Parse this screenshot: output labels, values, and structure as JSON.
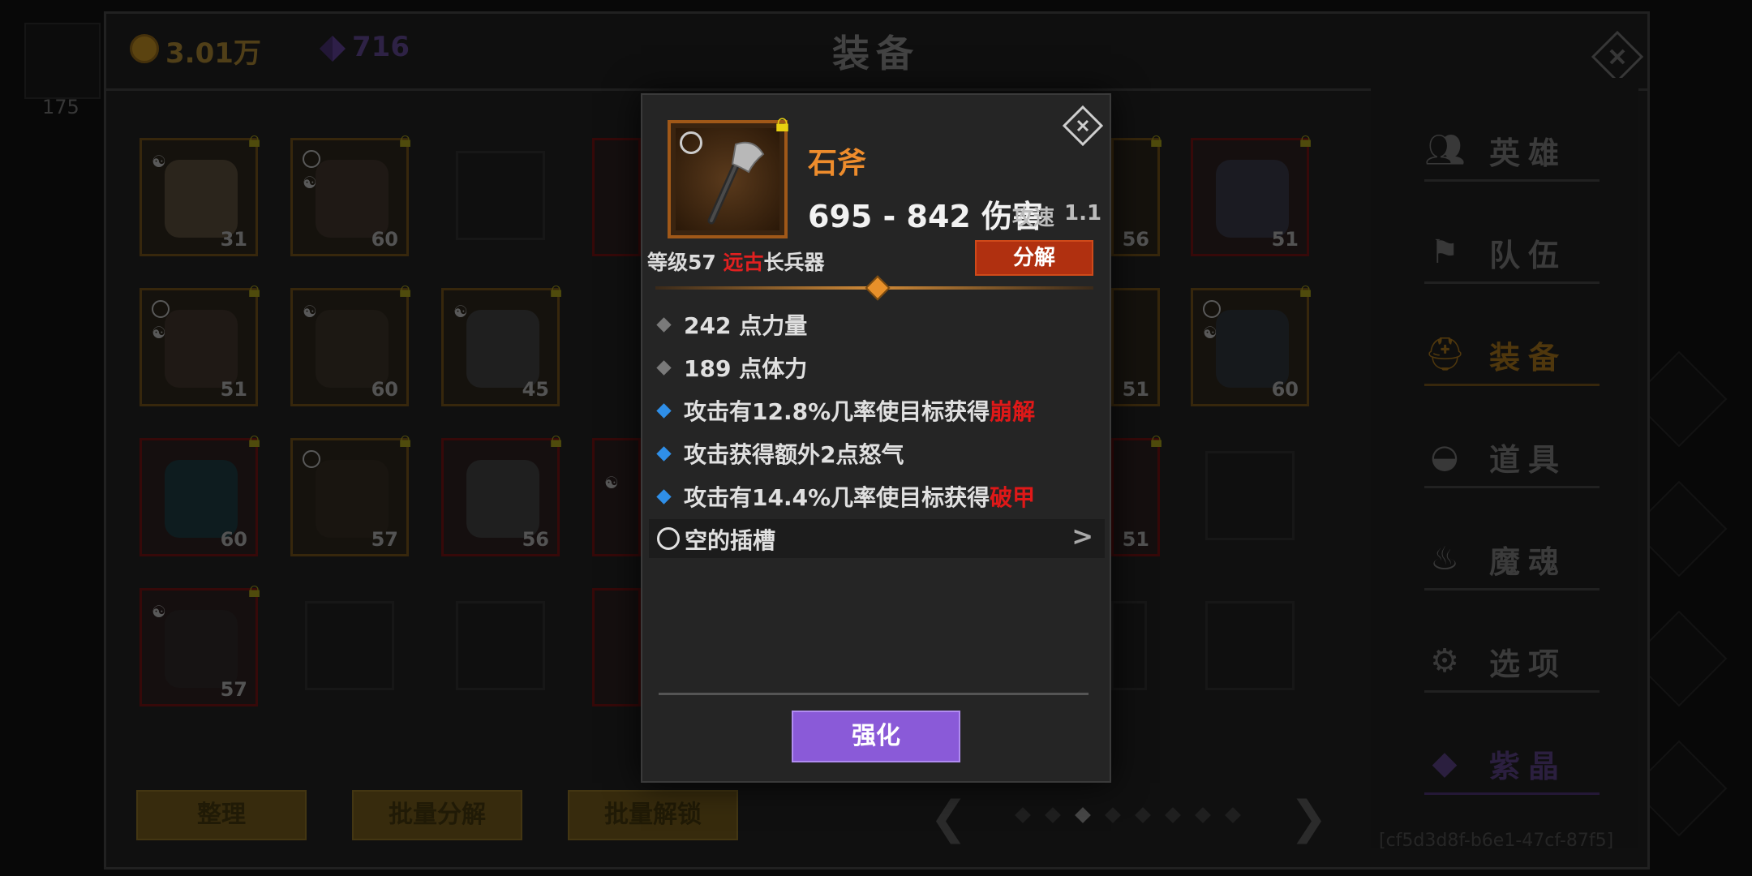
{
  "hud": {
    "left_number": "175"
  },
  "header": {
    "gold": "3.01万",
    "gems": "716",
    "title": "装备"
  },
  "inventory": {
    "items": [
      {
        "level": "31"
      },
      {
        "level": "60"
      },
      {
        "level": "56"
      },
      {
        "level": "51"
      },
      {
        "level": "51"
      },
      {
        "level": "60"
      },
      {
        "level": "45"
      },
      {
        "level": "51"
      },
      {
        "level": "60"
      },
      {
        "level": "60"
      },
      {
        "level": "57"
      },
      {
        "level": "56"
      },
      {
        "level": "51"
      },
      {
        "level": "57"
      }
    ]
  },
  "bottom_buttons": {
    "sort": "整理",
    "batch_decompose": "批量分解",
    "batch_unlock": "批量解锁"
  },
  "pager": {
    "total": 8,
    "current": 3
  },
  "nav": {
    "items": [
      {
        "label": "英雄",
        "icon": "users-icon"
      },
      {
        "label": "队伍",
        "icon": "flag-icon"
      },
      {
        "label": "装备",
        "icon": "helmet-icon",
        "active": true
      },
      {
        "label": "道具",
        "icon": "bag-icon"
      },
      {
        "label": "魔魂",
        "icon": "flame-icon"
      },
      {
        "label": "选项",
        "icon": "gear-icon"
      },
      {
        "label": "紫晶",
        "icon": "crystal-icon"
      }
    ]
  },
  "uuid": "[cf5d3d8f-b6e1-47cf-87f5]",
  "modal": {
    "name": "石斧",
    "damage": "695 - 842 伤害",
    "speed_label": "攻速",
    "speed_value": "1.1",
    "level_text": "等级57",
    "rarity": "远古",
    "type": "长兵器",
    "decompose": "分解",
    "stats": [
      {
        "text": "242 点力量",
        "kind": "base"
      },
      {
        "text": "189 点体力",
        "kind": "base"
      },
      {
        "text": "攻击有12.8%几率使目标获得",
        "highlight": "崩解",
        "kind": "affix"
      },
      {
        "text": "攻击获得额外2点怒气",
        "kind": "affix"
      },
      {
        "text": "攻击有14.4%几率使目标获得",
        "highlight": "破甲",
        "kind": "affix"
      }
    ],
    "socket": "空的插槽",
    "upgrade": "强化"
  },
  "colors": {
    "accent_orange": "#ee8c2c",
    "rarity_red": "#e01818",
    "affix_blue": "#2f8fe8",
    "upgrade_purple": "#8a5ad8",
    "decompose_red": "#b03010"
  }
}
